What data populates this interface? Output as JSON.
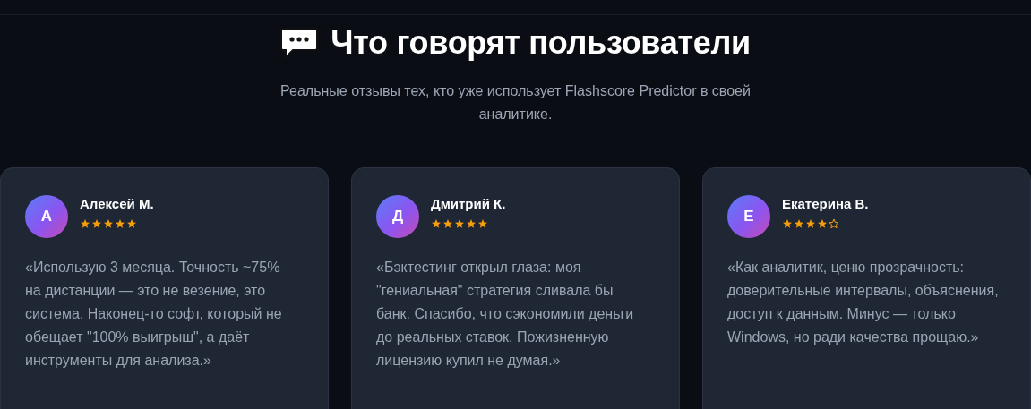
{
  "heading": {
    "title": "Что говорят пользователи",
    "subtitle": "Реальные отзывы тех, кто уже использует Flashscore Predictor в своей аналитике."
  },
  "reviews": [
    {
      "initial": "А",
      "name": "Алексей М.",
      "stars": 5,
      "text": "«Использую 3 месяца. Точность ~75% на дистанции — это не везение, это система. Наконец-то софт, который не обещает \"100% выигрыш\", а даёт инструменты для анализа.»"
    },
    {
      "initial": "Д",
      "name": "Дмитрий К.",
      "stars": 5,
      "text": "«Бэктестинг открыл глаза: моя \"гениальная\" стратегия сливала бы банк. Спасибо, что сэкономили деньги до реальных ставок. Пожизненную лицензию купил не думая.»"
    },
    {
      "initial": "Е",
      "name": "Екатерина В.",
      "stars": 4,
      "text": "«Как аналитик, ценю прозрачность: доверительные интервалы, объяснения, доступ к данным. Минус — только Windows, но ради качества прощаю.»"
    }
  ]
}
